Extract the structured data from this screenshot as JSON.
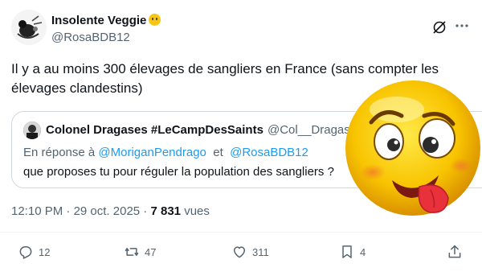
{
  "author": {
    "display_name": "Insolente Veggie",
    "handle": "@RosaBDB12"
  },
  "tweet": {
    "text": "Il y a au moins 300 élevages de sangliers en France (sans compter les élevages clandestins)"
  },
  "quoted": {
    "display_name": "Colonel Dragases #LeCampDesSaints",
    "handle": "@Col__Dragas",
    "reply_prefix": "En réponse à",
    "reply_mention_1": "@MoriganPendrago",
    "reply_join": "et",
    "reply_mention_2": "@RosaBDB12",
    "text": "que proposes tu pour réguler la population des sangliers ?"
  },
  "meta": {
    "time": "12:10 PM",
    "date": "29 oct. 2025",
    "views_count": "7 831",
    "views_label": "vues"
  },
  "actions": {
    "replies": "12",
    "reposts": "47",
    "likes": "311",
    "bookmarks": "4"
  },
  "icons": [
    "grok-icon",
    "more-icon",
    "reply-icon",
    "repost-icon",
    "like-icon",
    "bookmark-icon",
    "share-icon"
  ],
  "colors": {
    "text": "#0f1419",
    "secondary": "#536471",
    "link": "#1d9bf0",
    "border": "#cfd9de"
  }
}
